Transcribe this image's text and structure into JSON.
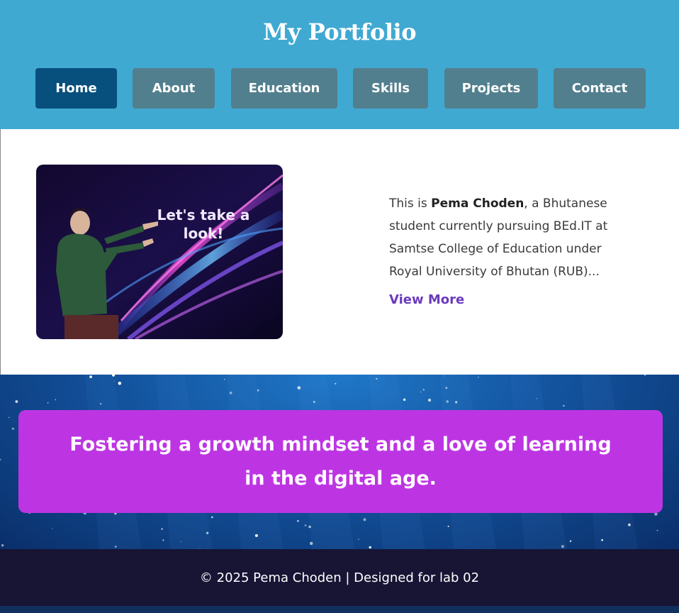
{
  "header": {
    "title": "My Portfolio",
    "nav": [
      {
        "label": "Home",
        "active": true
      },
      {
        "label": "About",
        "active": false
      },
      {
        "label": "Education",
        "active": false
      },
      {
        "label": "Skills",
        "active": false
      },
      {
        "label": "Projects",
        "active": false
      },
      {
        "label": "Contact",
        "active": false
      }
    ]
  },
  "intro": {
    "image_caption": "Let's take a look!",
    "prefix": "This is ",
    "name": "Pema Choden",
    "suffix": ", a Bhutanese student currently pursuing BEd.IT at Samtse College of Education under Royal University of Bhutan (RUB)...",
    "link": "View More"
  },
  "banner": {
    "quote": "Fostering a growth mindset and a love of learning in the digital age."
  },
  "footer": {
    "text": "© 2025 Pema Choden | Designed for lab 02"
  },
  "colors": {
    "header_bg": "#40a9d2",
    "nav_active": "#07507d",
    "nav_inactive": "#527f8e",
    "link": "#6b3bbd",
    "quote_box": "#bd35e3",
    "footer_bg": "#171434"
  }
}
